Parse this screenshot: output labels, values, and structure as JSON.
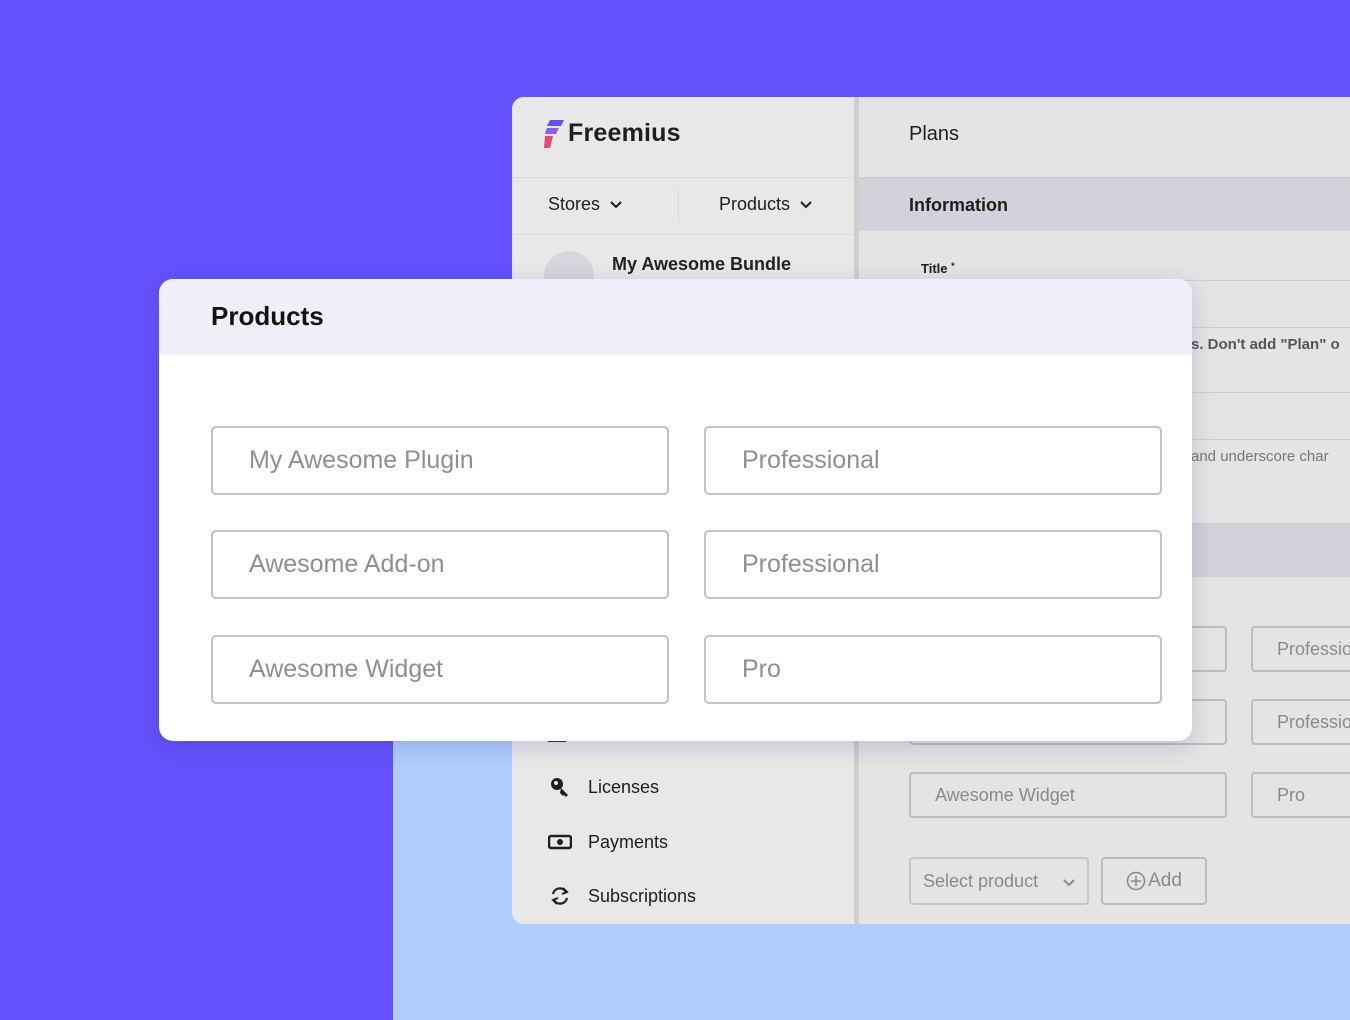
{
  "app": {
    "logo_text": "Freemius",
    "stores_label": "Stores",
    "products_label": "Products",
    "bundle_name": "My Awesome Bundle",
    "nav": {
      "licenses": "Licenses",
      "payments": "Payments",
      "subscriptions": "Subscriptions"
    },
    "main": {
      "title": "Plans",
      "info_label": "Information",
      "title_field_label": "Title",
      "required_mark": "*",
      "hint_1": "s. Don't add \"Plan\" o",
      "hint_2": "and underscore char"
    },
    "bg_fields": [
      {
        "product": "",
        "plan": "Professio"
      },
      {
        "product": "",
        "plan": "Professio"
      },
      {
        "product": "Awesome Widget",
        "plan": "Pro"
      }
    ],
    "select_placeholder": "Select product",
    "add_label": "Add"
  },
  "card": {
    "title": "Products",
    "rows": [
      {
        "product": "My Awesome Plugin",
        "plan": "Professional"
      },
      {
        "product": "Awesome Add-on",
        "plan": "Professional"
      },
      {
        "product": "Awesome Widget",
        "plan": "Pro"
      }
    ]
  },
  "colors": {
    "background": "#6552fe",
    "background_light": "#aecdfd",
    "card_header": "#efeffa",
    "logo_purple": "#6a4cf5",
    "logo_pink": "#e8467c"
  }
}
